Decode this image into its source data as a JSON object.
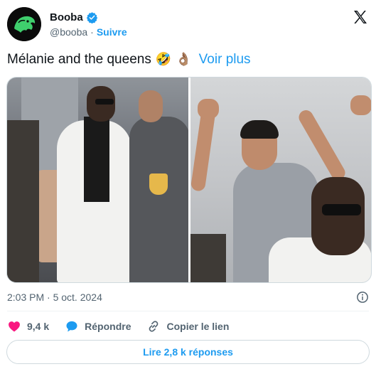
{
  "author": {
    "name": "Booba",
    "handle": "@booba",
    "separator": "·",
    "follow_label": "Suivre"
  },
  "tweet": {
    "text": "Mélanie and the queens",
    "emojis": [
      "🤣",
      "👌🏽"
    ],
    "see_more_label": "Voir plus"
  },
  "meta": {
    "timestamp": "2:03 PM · 5 oct. 2024"
  },
  "actions": {
    "likes": "9,4 k",
    "reply_label": "Répondre",
    "copy_link_label": "Copier le lien"
  },
  "replies_button_label": "Lire 2,8 k réponses",
  "colors": {
    "accent": "#1d9bf0",
    "like": "#f91880",
    "muted_text": "#536471"
  },
  "icons": [
    "x-logo-icon",
    "verified-badge-icon",
    "info-icon",
    "heart-icon",
    "reply-bubble-icon",
    "link-icon"
  ]
}
